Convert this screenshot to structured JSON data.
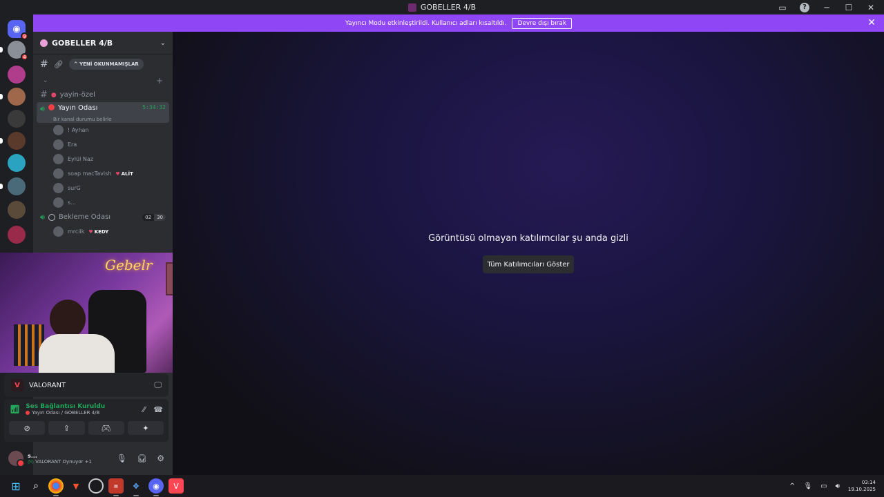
{
  "window": {
    "title": "GOBELLER 4/B"
  },
  "banner": {
    "text": "Yayıncı Modu etkinleştirildi. Kullanıcı adları kısaltıldı.",
    "button": "Devre dışı bırak"
  },
  "guilds": [
    {
      "name": "discord-home",
      "color": "#5865f2",
      "badge": "9",
      "glyph": "◉"
    },
    {
      "name": "server-1",
      "color": "#8a8f98",
      "badge": "4",
      "glyph": ""
    },
    {
      "name": "server-2",
      "color": "#b03c8c",
      "badge": "",
      "glyph": ""
    },
    {
      "name": "server-3",
      "color": "#a0684a",
      "badge": "",
      "glyph": ""
    },
    {
      "name": "server-4",
      "color": "#3a3a3a",
      "badge": "",
      "glyph": ""
    },
    {
      "name": "server-5",
      "color": "#5a3a2a",
      "badge": "",
      "glyph": ""
    },
    {
      "name": "server-6",
      "color": "#2aa3c0",
      "badge": "",
      "glyph": ""
    },
    {
      "name": "server-7",
      "color": "#4a6a7a",
      "badge": "",
      "glyph": ""
    },
    {
      "name": "server-8",
      "color": "#5a4a3a",
      "badge": "",
      "glyph": ""
    },
    {
      "name": "server-9",
      "color": "#9a2a4a",
      "badge": "",
      "glyph": ""
    }
  ],
  "server": {
    "name": "GOBELLER 4/B",
    "unread_button": "YENİ OKUNMAMIŞLAR"
  },
  "channels": {
    "text_channel": "yayin-özel",
    "voice_active": {
      "name": "Yayın Odası",
      "timer": "5:34:32",
      "status_hint": "Bir kanal durumu belirle"
    },
    "voice_members": [
      {
        "name": "! Ayhan",
        "tag": ""
      },
      {
        "name": "Era",
        "tag": ""
      },
      {
        "name": "Eylül Naz",
        "tag": ""
      },
      {
        "name": "soap macTavish",
        "tag": "ALİT"
      },
      {
        "name": "surG",
        "tag": ""
      },
      {
        "name": "s...",
        "tag": ""
      }
    ],
    "waiting_room": {
      "name": "Bekleme Odası",
      "count_a": "02",
      "count_b": "30"
    },
    "waiting_members": [
      {
        "name": "mrciik",
        "tag": "KEDY"
      }
    ]
  },
  "webcam": {
    "neon_text": "Gebelr"
  },
  "activity": {
    "game": "VALORANT"
  },
  "voice_panel": {
    "status": "Ses Bağlantısı Kuruldu",
    "location": "Yayın Odası / GOBELLER 4/B"
  },
  "user_panel": {
    "username": "s...",
    "status": "VALORANT Oynuyor +1"
  },
  "main": {
    "message": "Görüntüsü olmayan katılımcılar şu anda gizli",
    "show_all_button": "Tüm Katılımcıları Göster"
  },
  "taskbar": {
    "time": "03:14",
    "date": "19.10.2025"
  }
}
